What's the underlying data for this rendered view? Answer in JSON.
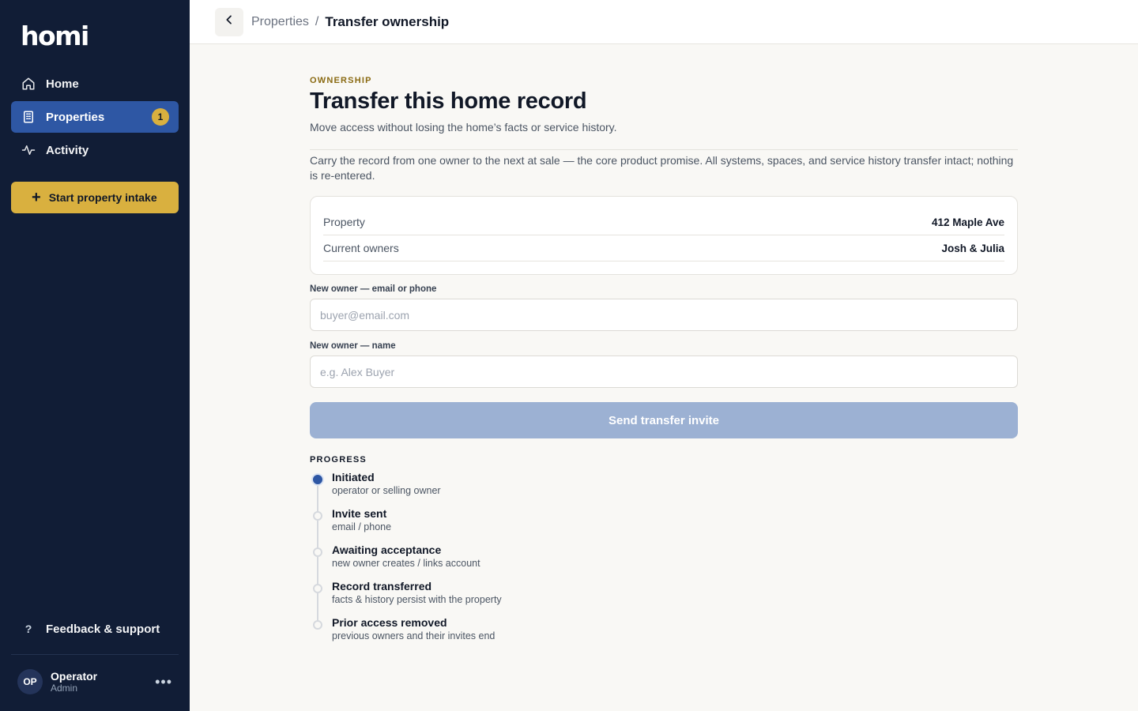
{
  "brand": {
    "name": "homi"
  },
  "sidebar": {
    "items": [
      {
        "label": "Home",
        "icon": "home-icon"
      },
      {
        "label": "Properties",
        "icon": "building-icon",
        "badge": "1",
        "active": true
      },
      {
        "label": "Activity",
        "icon": "activity-icon"
      }
    ],
    "intake_button": "Start property intake",
    "feedback": "Feedback & support",
    "user": {
      "initials": "OP",
      "name": "Operator",
      "role": "Admin"
    }
  },
  "topbar": {
    "breadcrumb_parent": "Properties",
    "breadcrumb_sep": "/",
    "breadcrumb_current": "Transfer ownership"
  },
  "main": {
    "eyebrow": "OWNERSHIP",
    "title": "Transfer this home record",
    "subtitle": "Move access without losing the home’s facts or service history.",
    "description": "Carry the record from one owner to the next at sale — the core product promise. All systems, spaces, and service history transfer intact; nothing is re-entered.",
    "summary": [
      {
        "label": "Property",
        "value": "412 Maple Ave"
      },
      {
        "label": "Current owners",
        "value": "Josh & Julia"
      }
    ],
    "fields": {
      "contact": {
        "label": "New owner — email or phone",
        "placeholder": "buyer@email.com",
        "value": ""
      },
      "name": {
        "label": "New owner — name",
        "placeholder": "e.g. Alex Buyer",
        "value": ""
      }
    },
    "send_button": "Send transfer invite",
    "progress": {
      "label": "PROGRESS",
      "steps": [
        {
          "title": "Initiated",
          "sub": "operator or selling owner",
          "done": true
        },
        {
          "title": "Invite sent",
          "sub": "email / phone",
          "done": false
        },
        {
          "title": "Awaiting acceptance",
          "sub": "new owner creates / links account",
          "done": false
        },
        {
          "title": "Record transferred",
          "sub": "facts & history persist with the property",
          "done": false
        },
        {
          "title": "Prior access removed",
          "sub": "previous owners and their invites end",
          "done": false
        }
      ]
    }
  },
  "colors": {
    "sidebar_bg": "#111d36",
    "accent": "#2e57a4",
    "gold": "#d9b03f",
    "button_disabled": "#9cb1d3"
  }
}
